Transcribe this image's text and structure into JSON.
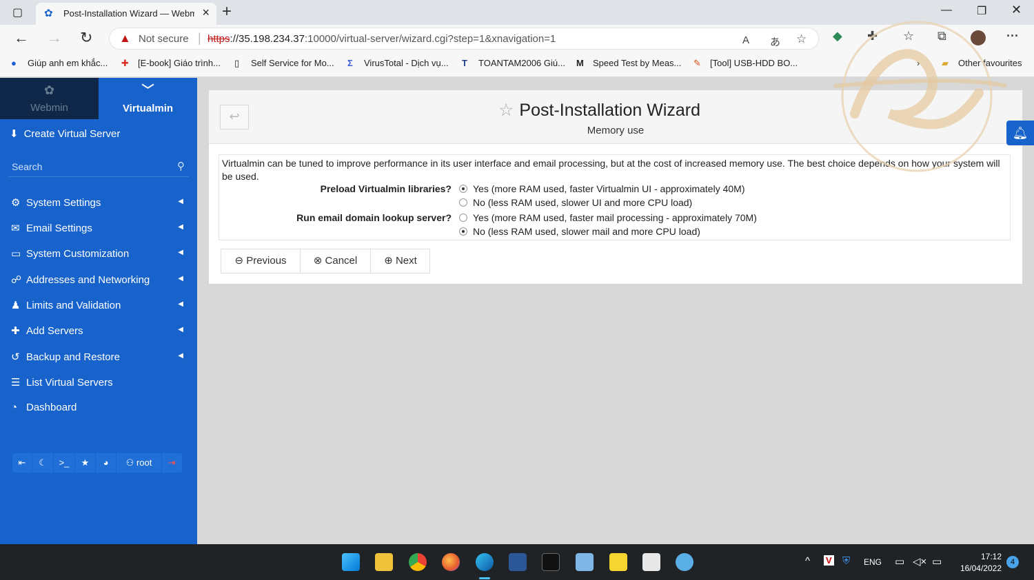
{
  "browser": {
    "tab_title": "Post-Installation Wizard — Webmin",
    "not_secure": "Not secure",
    "url_scheme": "https",
    "url_host": "://35.198.234.37",
    "url_rest": ":10000/virtual-server/wizard.cgi?step=1&xnavigation=1",
    "favourites": [
      "Giúp anh em khắc...",
      "[E-book] Giáo trình...",
      "Self Service for Mo...",
      "VirusTotal - Dịch vụ...",
      "TOANTAM2006 Giú...",
      "Speed Test by Meas...",
      "[Tool] USB-HDD BO...",
      "Other favourites"
    ]
  },
  "sidebar": {
    "switch_webmin": "Webmin",
    "switch_virtualmin": "Virtualmin",
    "create_server": "Create Virtual Server",
    "search_placeholder": "Search",
    "items": [
      {
        "label": "System Settings"
      },
      {
        "label": "Email Settings"
      },
      {
        "label": "System Customization"
      },
      {
        "label": "Addresses and Networking"
      },
      {
        "label": "Limits and Validation"
      },
      {
        "label": "Add Servers"
      },
      {
        "label": "Backup and Restore"
      },
      {
        "label": "List Virtual Servers"
      },
      {
        "label": "Dashboard"
      }
    ],
    "user": "root"
  },
  "main": {
    "title": "Post-Installation Wizard",
    "subtitle": "Memory use",
    "intro": "Virtualmin can be tuned to improve performance in its user interface and email processing, but at the cost of increased memory use. The best choice depends on how your system will be used.",
    "q1_label": "Preload Virtualmin libraries?",
    "q1_yes": "Yes (more RAM used, faster Virtualmin UI - approximately 40M)",
    "q1_no": "No (less RAM used, slower UI and more CPU load)",
    "q2_label": "Run email domain lookup server?",
    "q2_yes": "Yes (more RAM used, faster mail processing - approximately 70M)",
    "q2_no": "No (less RAM used, slower mail and more CPU load)",
    "btn_previous": "Previous",
    "btn_cancel": "Cancel",
    "btn_next": "Next"
  },
  "taskbar": {
    "lang": "ENG",
    "time": "17:12",
    "date": "16/04/2022",
    "notifications": "4"
  },
  "colors": {
    "sidebar": "#1763cb",
    "sidebar_dark": "#0f2748",
    "taskbar": "#202326"
  }
}
